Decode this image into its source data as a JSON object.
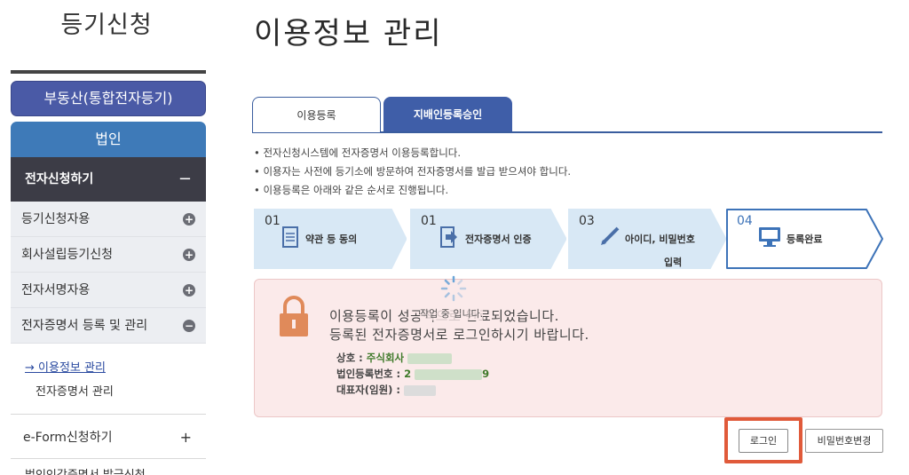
{
  "sidebar": {
    "brand": "등기신청",
    "realestate_button": "부동산(통합전자등기)",
    "corp_button": "법인",
    "section_title": "전자신청하기",
    "section_toggle": "−",
    "items": [
      {
        "label": "등기신청자용",
        "toggle": "+"
      },
      {
        "label": "회사설립등기신청",
        "toggle": "+"
      },
      {
        "label": "전자서명자용",
        "toggle": "+"
      },
      {
        "label": "전자증명서 등록 및 관리",
        "toggle": "−"
      }
    ],
    "submenu": {
      "active": "→ 이용정보 관리",
      "other": "전자증명서 관리"
    },
    "eform": {
      "label": "e-Form신청하기",
      "toggle": "+"
    },
    "cut_item": "법인인감증명서 발급신청"
  },
  "main": {
    "title": "이용정보 관리",
    "tabs": [
      {
        "label": "이용등록",
        "active": true
      },
      {
        "label": "지배인등록승인",
        "active": false
      }
    ],
    "bullets": [
      "• 전자신청시스템에 전자증명서 이용등록합니다.",
      "• 이용자는 사전에 등기소에 방문하여 전자증명서를 발급 받으셔야 합니다.",
      "• 이용등록은 아래와 같은 순서로 진행됩니다."
    ],
    "steps": [
      {
        "num": "01",
        "label": "약관 등 동의",
        "icon": "document-icon"
      },
      {
        "num": "01",
        "label": "전자증명서 인증",
        "icon": "arrow-right-icon"
      },
      {
        "num": "03",
        "label": "아이디, 비밀번호",
        "label2": "입력",
        "icon": "pencil-icon"
      },
      {
        "num": "04",
        "label": "등록완료",
        "icon": "monitor-icon",
        "current": true
      }
    ],
    "result": {
      "line1": "이용등록이 성공적으로 완료되었습니다.",
      "line2": "등록된 전자증명서로 로그인하시기 바랍니다.",
      "loading": "작업 중 입니다.",
      "company_label": "상호 : ",
      "company_value": "주식회사",
      "regno_label": "법인등록번호 : ",
      "regno_prefix": "2",
      "regno_suffix": "9",
      "rep_label": "대표자(임원) : "
    },
    "buttons": {
      "login": "로그인",
      "change_password": "비밀번호변경"
    }
  },
  "colors": {
    "tab_active_border": "#3a5d9e",
    "tab_inactive_bg": "#3f5ea8",
    "sidebar_dark": "#3c3c46",
    "realestate_bg": "#4a5aa6",
    "corp_bg": "#3e7ab8",
    "result_bg": "#fbeaea",
    "highlight": "#e05a3a",
    "info_green": "#3f7a2a",
    "lock_orange": "#e08a5a"
  }
}
